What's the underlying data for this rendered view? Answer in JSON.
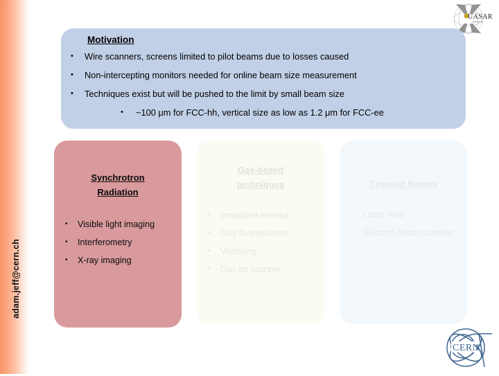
{
  "side_bar": {
    "email": "adam.jeff@cern.ch"
  },
  "logos": {
    "top_right": "quasar-group-logo",
    "bottom_right": "cern-logo",
    "cern_label": "CERN",
    "quasar_label": "QUASAR",
    "quasar_sub": "GROUP"
  },
  "motivation": {
    "title": "Motivation",
    "bullet": "•",
    "items": [
      "Wire scanners, screens limited to pilot beams due to losses caused",
      "Non-intercepting monitors needed for online beam size measurement",
      "Techniques exist but will be pushed to the limit by small beam size"
    ],
    "sub_item": "~100 μm for FCC-hh, vertical size as low as 1.2 μm for FCC-ee"
  },
  "panels": [
    {
      "id": "synchrotron-radiation",
      "title": "Synchrotron\nRadiation",
      "title_line1": "Synchrotron",
      "title_line2": "Radiation",
      "color": "#d99a9d",
      "items": [
        "Visible light imaging",
        "Interferometry",
        "X-ray imaging"
      ]
    },
    {
      "id": "gas-based-techniques",
      "title": "Gas-based techniques",
      "title_line1": "Gas-based",
      "title_line2": "techniques",
      "color": "#fafcf3",
      "items": [
        "Ionisation monitor",
        "Gas fluorescence",
        "Vertexing",
        "Gas jet scanner"
      ]
    },
    {
      "id": "crossed-beams",
      "title": "Crossed Beams",
      "title_line1": "Crossed Beams",
      "title_line2": "",
      "color": "#f3f8fc",
      "items": [
        "Laser-wire",
        "Electron-beam scanner"
      ]
    }
  ],
  "colors": {
    "motivation_bg": "#c2d0e7",
    "sidebar_gradient_start": "#f79267",
    "sidebar_gradient_end": "#ffffff",
    "cern_blue": "#3f6590"
  }
}
